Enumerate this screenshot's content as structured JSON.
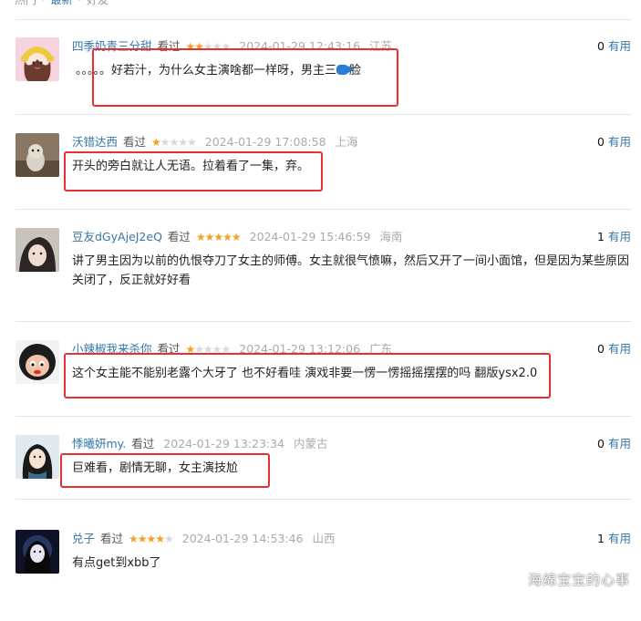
{
  "tabs": [
    "热门",
    "最新",
    "好友"
  ],
  "comments": [
    {
      "user": "四季奶青三分甜",
      "status": "看过",
      "stars": 2,
      "time": "2024-01-29 12:43:16",
      "location": "江苏",
      "votes": "0",
      "vote_label": "有用",
      "text": "。。。。。好若汁，为什么女主演啥都一样呀，男主三",
      "text_tail": "脸",
      "icon": "fish-emoji-icon"
    },
    {
      "user": "沃错达西",
      "status": "看过",
      "stars": 1,
      "time": "2024-01-29 17:08:58",
      "location": "上海",
      "votes": "0",
      "vote_label": "有用",
      "text": "开头的旁白就让人无语。拉着看了一集，弃。"
    },
    {
      "user": "豆友dGyAjeJ2eQ",
      "status": "看过",
      "stars": 5,
      "time": "2024-01-29 15:46:59",
      "location": "海南",
      "votes": "1",
      "vote_label": "有用",
      "text": "讲了男主因为以前的仇恨夺刀了女主的师傅。女主就很气愤嘛，然后又开了一间小面馆，但是因为某些原因关闭了，反正就好好看"
    },
    {
      "user": "小辣椒我来杀你",
      "status": "看过",
      "stars": 1,
      "time": "2024-01-29 13:12:06",
      "location": "广东",
      "votes": "0",
      "vote_label": "有用",
      "text": "这个女主能不能别老露个大牙了 也不好看哇 演戏非要一愣一愣摇摇摆摆的吗 翻版ysx2.0"
    },
    {
      "user": "悸曦妍my.",
      "status": "看过",
      "stars": 0,
      "time": "2024-01-29 13:23:34",
      "location": "内蒙古",
      "votes": "0",
      "vote_label": "有用",
      "text": "巨难看，剧情无聊，女主演技尬"
    },
    {
      "user": "兑子",
      "status": "看过",
      "stars": 4,
      "time": "2024-01-29 14:53:46",
      "location": "山西",
      "votes": "1",
      "vote_label": "有用",
      "text": "有点get到xbb了"
    }
  ],
  "watermark": "海绵宝宝的心事",
  "colors": {
    "link": "#3377aa",
    "star": "#f4a020",
    "highlight": "#e53131"
  }
}
